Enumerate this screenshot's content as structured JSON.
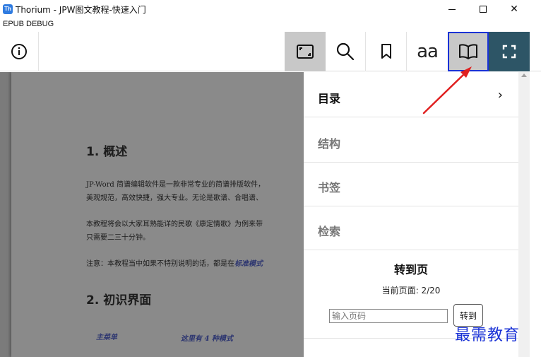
{
  "window": {
    "title": "Thorium - JPW图文教程-快速入门",
    "icon_label": "Th",
    "controls": [
      "minimize",
      "maximize",
      "close"
    ],
    "close_glyph": "✕"
  },
  "menubar": {
    "label": "EPUB DEBUG"
  },
  "toolbar": {
    "info_icon": "info-icon",
    "fit_icon": "fit-page-icon",
    "search_icon": "search-icon",
    "bookmark_icon": "bookmark-icon",
    "font_settings_label": "aa",
    "toc_icon": "book-open-icon",
    "fullscreen_icon": "fullscreen-icon"
  },
  "document": {
    "section1_heading": "1. 概述",
    "para1_line1": "JP-Word 简谱编辑软件是一款非常专业的简谱排版软件，",
    "para1_line2": "美观规范，高效快捷，强大专业。无论是歌谱、合唱谱、",
    "para2_line1": "本教程将会以大家耳熟能详的民歌《康定情歌》为例来带",
    "para2_line2": "只需要二三十分钟。",
    "para3_prefix": "注意：本教程当中如果不特别说明的话，都是在",
    "para3_emphasis": "标准模式",
    "section2_heading": "2. 初识界面",
    "caption_left": "主菜单",
    "caption_right": "这里有 4 种模式"
  },
  "panel": {
    "items": [
      {
        "label": "目录",
        "active": true
      },
      {
        "label": "结构",
        "active": false
      },
      {
        "label": "书签",
        "active": false
      },
      {
        "label": "检索",
        "active": false
      }
    ],
    "chevron": "›",
    "goto_title": "转到页",
    "current_page": "当前页面: 2/20",
    "page_input_placeholder": "输入页码",
    "goto_button": "转到"
  },
  "colors": {
    "accent_border": "#1a32d6",
    "fullscreen_bg": "#2d5566",
    "active_tool_bg": "#c8c8c8",
    "annotation_arrow": "#e02020"
  },
  "watermark": "最需教育"
}
